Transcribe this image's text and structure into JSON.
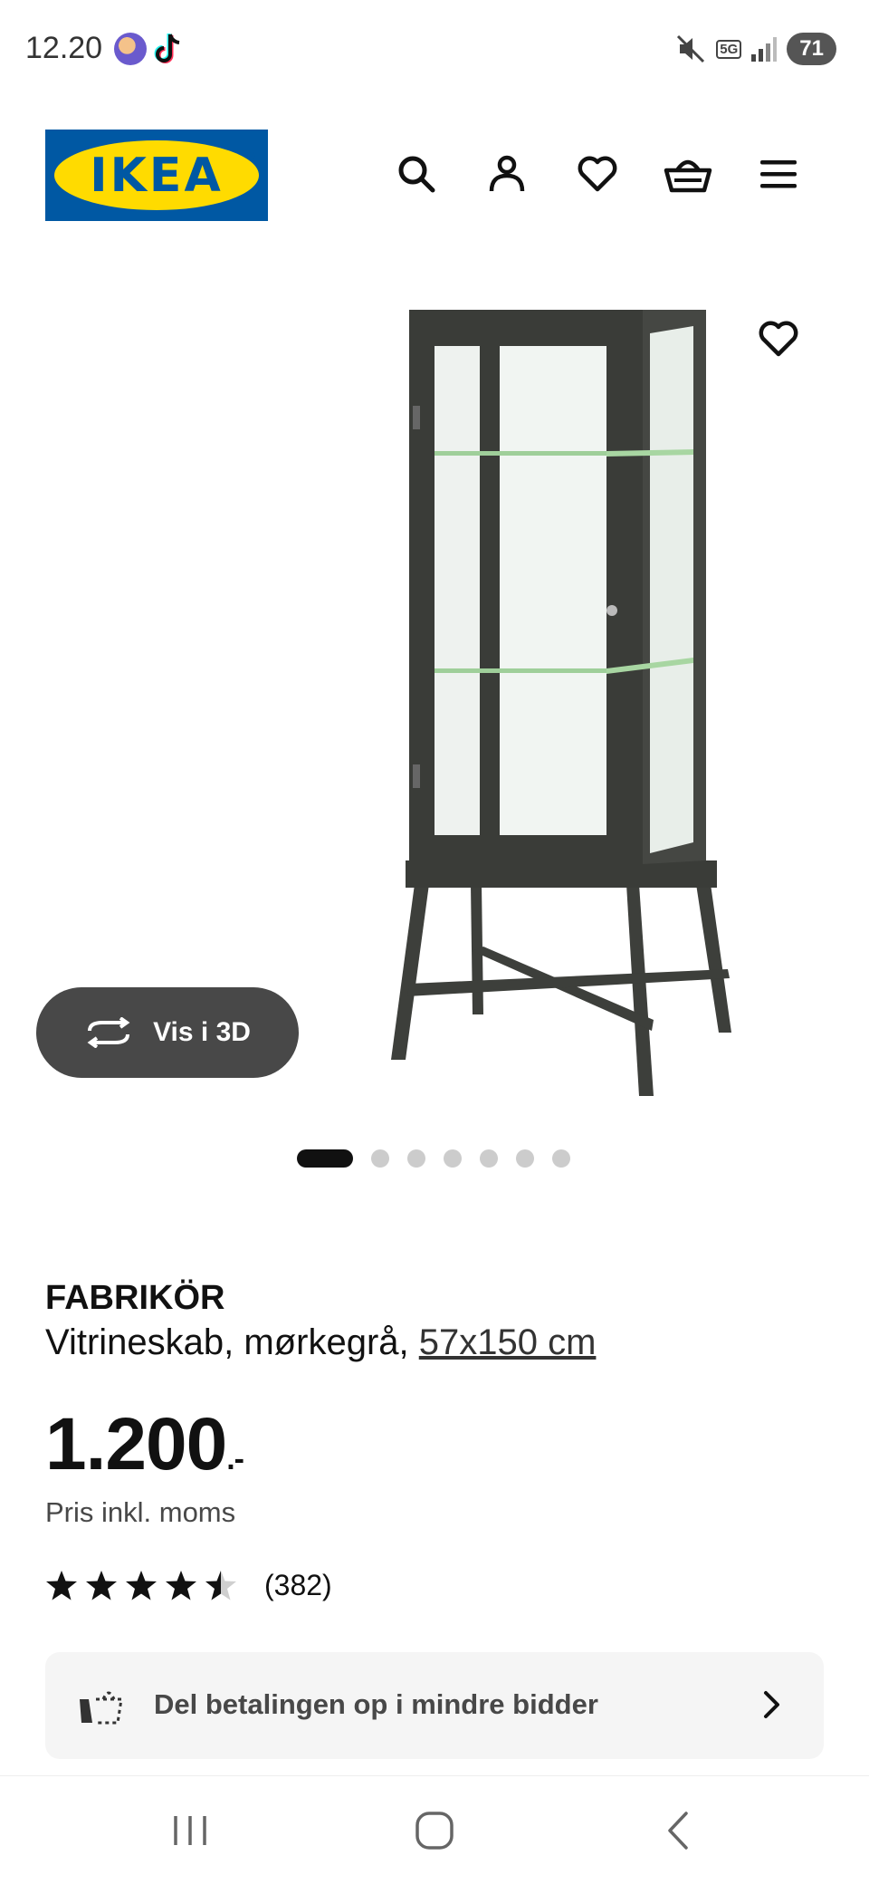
{
  "status_bar": {
    "time": "12.20",
    "network": "5G",
    "battery": "71"
  },
  "header": {
    "logo_text": "IKEA"
  },
  "gallery": {
    "vis3d_label": "Vis i 3D",
    "dot_count": 7,
    "active_index": 0
  },
  "product": {
    "name": "FABRIKÖR",
    "description": "Vitrineskab, mørkegrå,",
    "size": "57x150 cm",
    "price": "1.200",
    "price_suffix": ".-",
    "tax_note": "Pris inkl. moms",
    "rating": 4.5,
    "rating_count": "(382)"
  },
  "installment": {
    "label": "Del betalingen op i mindre bidder"
  },
  "colors": {
    "ikea_blue": "#0058a3",
    "ikea_yellow": "#ffdb00",
    "pill": "#484848"
  }
}
